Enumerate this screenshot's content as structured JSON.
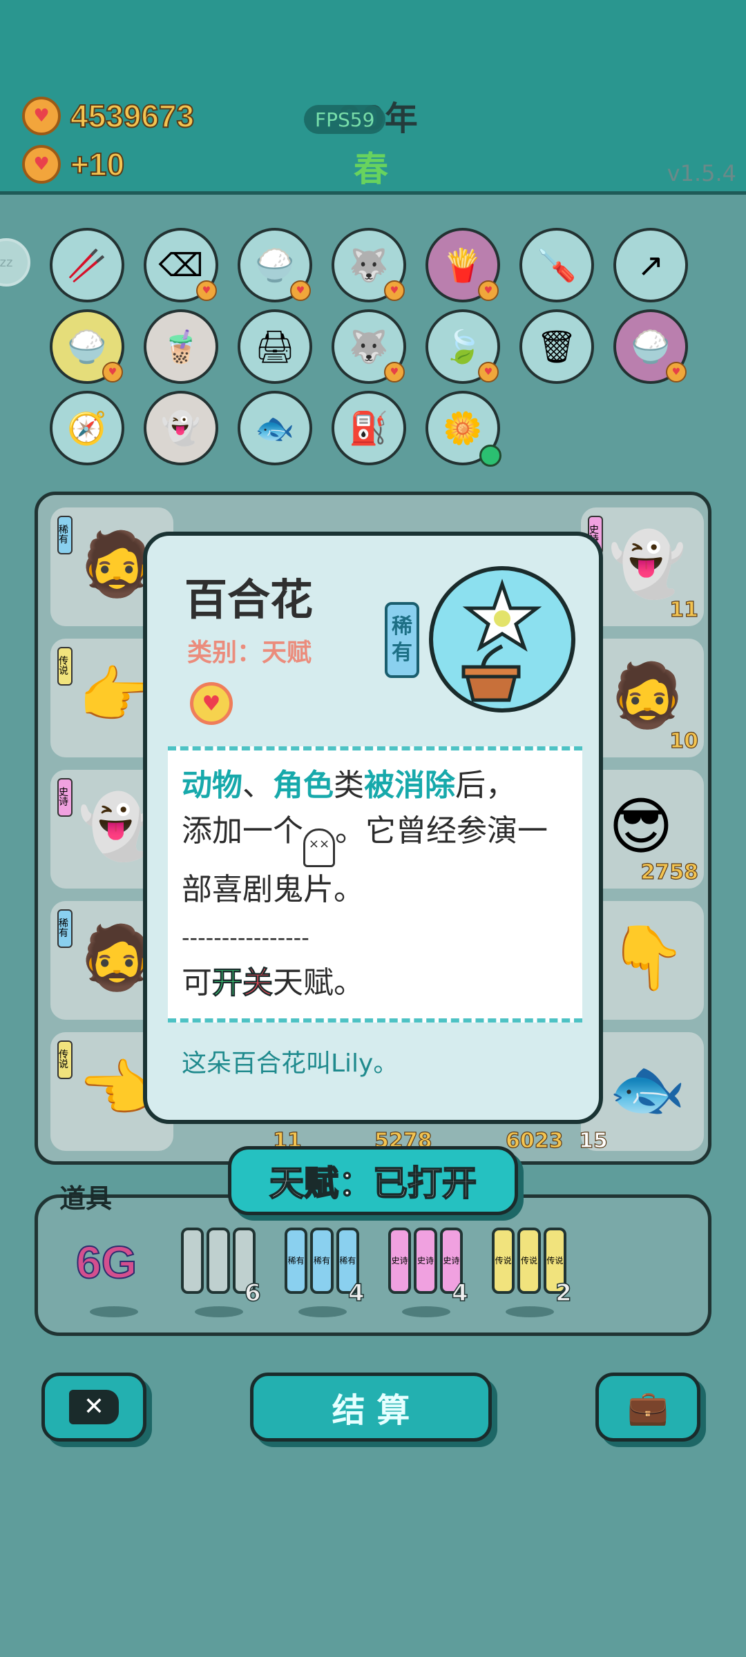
{
  "header": {
    "coins_total": "4539673",
    "coins_income": "+10",
    "year": "90年",
    "fps": "FPS59",
    "season": "春",
    "version": "v1.5.4"
  },
  "items": [
    {
      "name": "chopsticks-icon",
      "glyph": "🥢",
      "bg": "",
      "badge": false
    },
    {
      "name": "delete-tag-icon",
      "glyph": "⌫",
      "bg": "",
      "badge": true
    },
    {
      "name": "rice-bowl-icon",
      "glyph": "🍚",
      "bg": "",
      "badge": true
    },
    {
      "name": "husky-dog-icon",
      "glyph": "🐺",
      "bg": "",
      "badge": true
    },
    {
      "name": "fries-icon",
      "glyph": "🍟",
      "bg": "purple",
      "badge": true
    },
    {
      "name": "screwdriver-icon",
      "glyph": "🪛",
      "bg": "",
      "badge": false
    },
    {
      "name": "arrow-card-icon",
      "glyph": "↗",
      "bg": "",
      "badge": false
    },
    {
      "name": "rice-bowl-icon",
      "glyph": "🍚",
      "bg": "yellow",
      "badge": true
    },
    {
      "name": "bubble-tea-icon",
      "glyph": "🧋",
      "bg": "white",
      "badge": false
    },
    {
      "name": "printer-icon",
      "glyph": "🖨",
      "bg": "",
      "badge": false
    },
    {
      "name": "husky-dog-icon",
      "glyph": "🐺",
      "bg": "",
      "badge": true
    },
    {
      "name": "leaf-icon",
      "glyph": "🍃",
      "bg": "",
      "badge": true
    },
    {
      "name": "garbage-bag-icon",
      "glyph": "🗑",
      "bg": "",
      "badge": false
    },
    {
      "name": "rice-bowl-icon",
      "glyph": "🍚",
      "bg": "purple",
      "badge": true
    },
    {
      "name": "compass-icon",
      "glyph": "🧭",
      "bg": "",
      "badge": false
    },
    {
      "name": "ghost-icon",
      "glyph": "👻",
      "bg": "white",
      "badge": false
    },
    {
      "name": "fish-bowl-icon",
      "glyph": "🐟",
      "bg": "",
      "badge": false
    },
    {
      "name": "air-pump-icon",
      "glyph": "⛽",
      "bg": "",
      "badge": false
    },
    {
      "name": "lily-flower-icon",
      "glyph": "🌼",
      "bg": "",
      "badge": false
    }
  ],
  "board": {
    "values": [
      "11",
      "10",
      "2758",
      "6023",
      "15",
      "11",
      "5278"
    ],
    "tags": {
      "rare": "稀有",
      "legend": "传说",
      "epic": "史诗"
    }
  },
  "tools": {
    "label": "道具",
    "g6": "6G",
    "counts": [
      "6",
      "4",
      "4",
      "2"
    ],
    "pack_labels": [
      "稀有",
      "史诗",
      "传说"
    ]
  },
  "buttons": {
    "settle": "结 算"
  },
  "modal": {
    "title": "百合花",
    "category": "类别：天赋",
    "rarity_line1": "稀",
    "rarity_line2": "有",
    "desc_1": "动物",
    "desc_2": "、",
    "desc_3": "角色",
    "desc_4": "类",
    "desc_5": "被消除",
    "desc_6": "后，",
    "desc_7": "添加一个",
    "desc_8": "。它曾经参演一部喜剧鬼片。",
    "desc_sep": "----------------",
    "desc_9": "可",
    "desc_10": "开",
    "desc_11": "关",
    "desc_12": "天赋。",
    "flavor": "这朵百合花叫Lily。"
  },
  "talent_button": "天赋：已打开"
}
